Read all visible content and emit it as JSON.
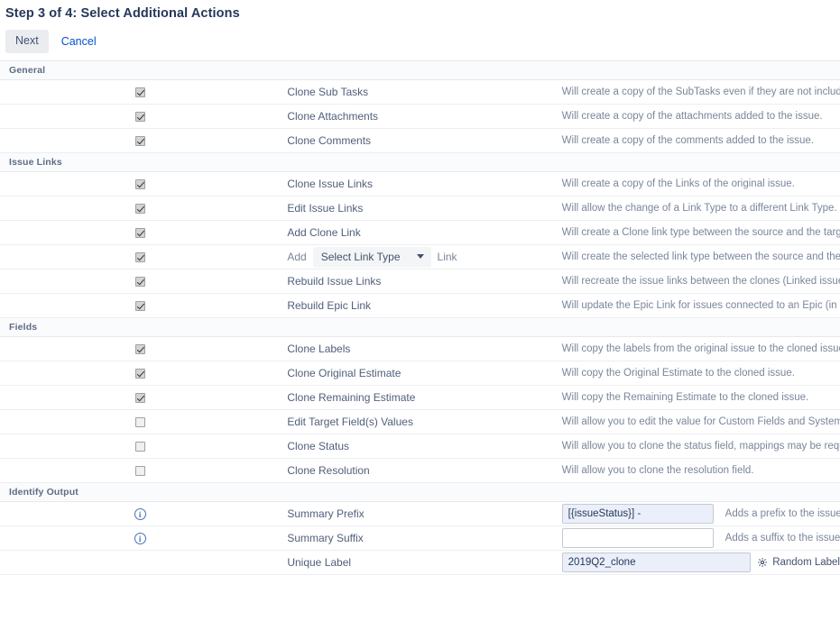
{
  "header": {
    "title": "Step 3 of 4: Select Additional Actions",
    "next_label": "Next",
    "cancel_label": "Cancel"
  },
  "sections": [
    {
      "name": "General",
      "rows": [
        {
          "label": "Clone Sub Tasks",
          "checked": true,
          "description": "Will create a copy of the SubTasks even if they are not included in the search."
        },
        {
          "label": "Clone Attachments",
          "checked": true,
          "description": "Will create a copy of the attachments added to the issue."
        },
        {
          "label": "Clone Comments",
          "checked": true,
          "description": "Will create a copy of the comments added to the issue."
        }
      ]
    },
    {
      "name": "Issue Links",
      "rows": [
        {
          "label": "Clone Issue Links",
          "checked": true,
          "description": "Will create a copy of the Links of the original issue."
        },
        {
          "label": "Edit Issue Links",
          "checked": true,
          "indented": true,
          "description": "Will allow the change of a Link Type to a different Link Type."
        },
        {
          "label": "Add Clone Link",
          "checked": true,
          "description": "Will create a Clone link type between the source and the target issues."
        },
        {
          "label": "Add",
          "checked": true,
          "select": {
            "value": "Select Link Type"
          },
          "suffix_label": "Link",
          "description": "Will create the selected link type between the source and the target issues."
        },
        {
          "label": "Rebuild Issue Links",
          "checked": true,
          "description": "Will recreate the issue links between the clones (Linked issues must be included in this clone operation)."
        },
        {
          "label": "Rebuild Epic Link",
          "checked": true,
          "description": "Will update the Epic Link for issues connected to an Epic (in case the linked Epic is also cloned)."
        }
      ]
    },
    {
      "name": "Fields",
      "rows": [
        {
          "label": "Clone Labels",
          "checked": true,
          "description": "Will copy the labels from the original issue to the cloned issue."
        },
        {
          "label": "Clone Original Estimate",
          "checked": true,
          "description": "Will copy the Original Estimate to the cloned issue."
        },
        {
          "label": "Clone Remaining Estimate",
          "checked": true,
          "description": "Will copy the Remaining Estimate to the cloned issue."
        },
        {
          "label": "Edit Target Field(s) Values",
          "checked": false,
          "description": "Will allow you to edit the value for Custom Fields and System Fields (Priority, Versions, Component/s, etc.)"
        },
        {
          "label": "Clone Status",
          "checked": false,
          "description": "Will allow you to clone the status field, mappings may be required."
        },
        {
          "label": "Clone Resolution",
          "checked": false,
          "description": "Will allow you to clone the resolution field."
        }
      ]
    }
  ],
  "identify_output": {
    "name": "Identify Output",
    "summary_prefix": {
      "label": "Summary Prefix",
      "value": "[{issueStatus}] -",
      "hint": "Adds a prefix to the issue summary. Type in a prefix and a separator."
    },
    "summary_suffix": {
      "label": "Summary Suffix",
      "value": "",
      "hint": "Adds a suffix to the issue summary. Type in a separator and a suffix."
    },
    "unique_label": {
      "label": "Unique Label",
      "value": "2019Q2_clone",
      "random_button": "Random Label"
    }
  },
  "colors": {
    "link": "#0052cc",
    "text": "#42526e",
    "muted": "#7a869a",
    "input_filled": "#eaeffa"
  }
}
